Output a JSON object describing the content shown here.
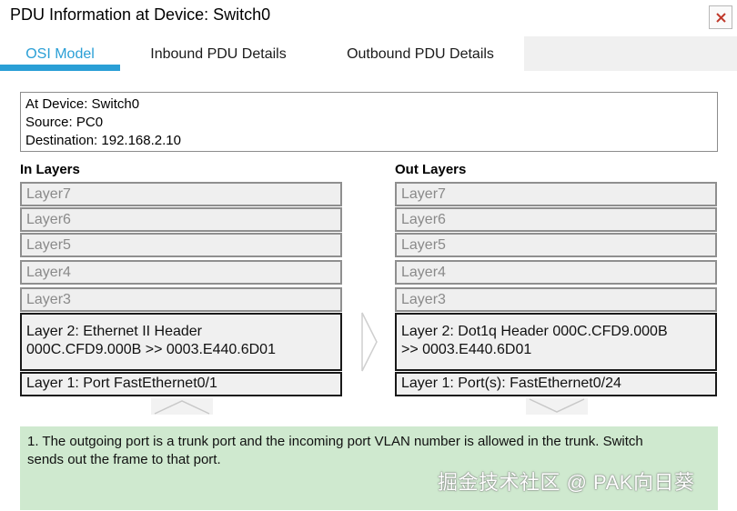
{
  "window": {
    "title": "PDU Information at Device: Switch0",
    "close_label": "x"
  },
  "tabs": [
    {
      "label": "OSI Model",
      "active": true
    },
    {
      "label": "Inbound PDU Details",
      "active": false
    },
    {
      "label": "Outbound PDU Details",
      "active": false
    }
  ],
  "info": {
    "device": "At Device: Switch0",
    "source": "Source: PC0",
    "destination": "Destination: 192.168.2.10"
  },
  "in_layers": {
    "heading": "In Layers",
    "layer7": "Layer7",
    "layer6": "Layer6",
    "layer5": "Layer5",
    "layer4": "Layer4",
    "layer3": "Layer3",
    "layer2_line1": "Layer 2: Ethernet II Header",
    "layer2_line2": "000C.CFD9.000B >> 0003.E440.6D01",
    "layer1": "Layer 1: Port FastEthernet0/1"
  },
  "out_layers": {
    "heading": "Out Layers",
    "layer7": "Layer7",
    "layer6": "Layer6",
    "layer5": "Layer5",
    "layer4": "Layer4",
    "layer3": "Layer3",
    "layer2_line1": "Layer 2: Dot1q Header 000C.CFD9.000B",
    "layer2_line2": ">> 0003.E440.6D01",
    "layer1": "Layer 1: Port(s): FastEthernet0/24"
  },
  "message": {
    "line1": "1. The outgoing port is a trunk port and the incoming port VLAN number is allowed in the trunk. Switch",
    "line2": "sends out the frame to that port."
  },
  "watermark": "掘金技术社区 @ PAK向日葵",
  "colors": {
    "accent": "#2a9fd6",
    "message_bg": "#cfe9cf",
    "layer_bg": "#efefef"
  }
}
